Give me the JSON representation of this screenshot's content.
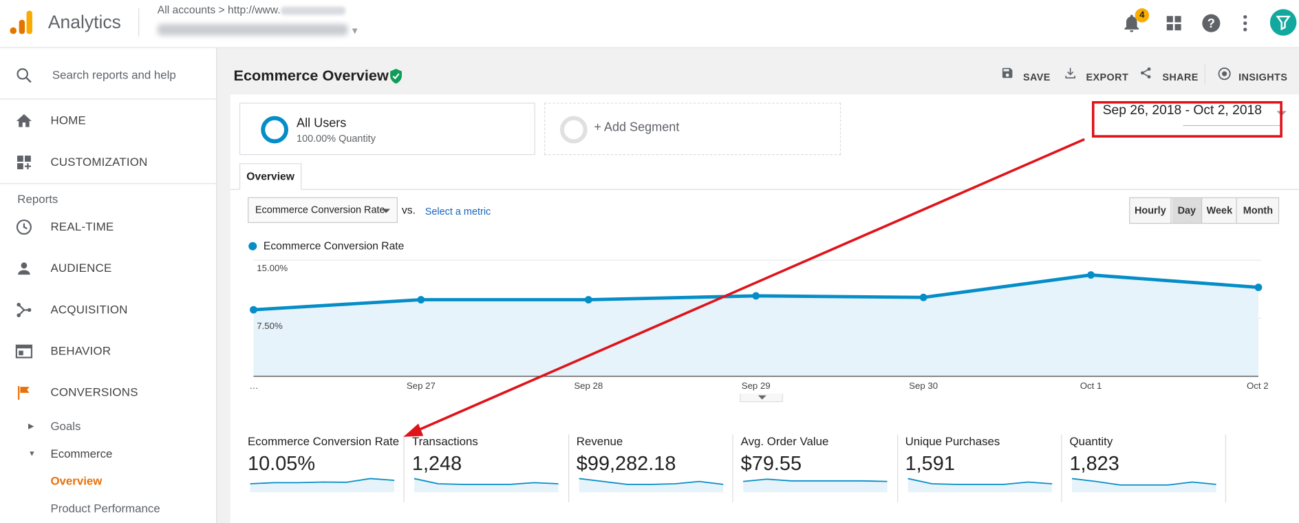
{
  "app": {
    "title": "Analytics",
    "breadcrumb_prefix": "All accounts",
    "breadcrumb_sep": ">",
    "breadcrumb_url": "http://www.",
    "property_dropdown": "▾",
    "notifications_count": "4",
    "brand_colors": {
      "logo_orange": "#f9ab00",
      "logo_dark": "#e37400",
      "accent_blue": "#058dc7",
      "active_orange": "#e8710a",
      "annotation_red": "#e0131a"
    }
  },
  "sidebar": {
    "search_placeholder": "Search reports and help",
    "home": "HOME",
    "customization": "CUSTOMIZATION",
    "reports_heading": "Reports",
    "realtime": "REAL-TIME",
    "audience": "AUDIENCE",
    "acquisition": "ACQUISITION",
    "behavior": "BEHAVIOR",
    "conversions": "CONVERSIONS",
    "goals": "Goals",
    "ecommerce": "Ecommerce",
    "overview": "Overview",
    "product_performance": "Product Performance"
  },
  "report": {
    "title": "Ecommerce Overview",
    "actions": {
      "save": "SAVE",
      "export": "EXPORT",
      "share": "SHARE",
      "insights": "INSIGHTS"
    },
    "segment": {
      "name": "All Users",
      "sub": "100.00% Quantity",
      "add": "+ Add Segment"
    },
    "date_range": "Sep 26, 2018 - Oct 2, 2018",
    "tab": "Overview",
    "metric_select": "Ecommerce Conversion Rate",
    "vs": "vs.",
    "select_metric": "Select a metric",
    "granularity": [
      "Hourly",
      "Day",
      "Week",
      "Month"
    ],
    "granularity_active": "Day",
    "legend": "Ecommerce Conversion Rate"
  },
  "chart_data": {
    "type": "area",
    "series": [
      {
        "name": "Ecommerce Conversion Rate",
        "values": [
          8.6,
          9.9,
          9.9,
          10.4,
          10.2,
          13.1,
          11.5
        ]
      }
    ],
    "x": [
      "…",
      "Sep 27",
      "Sep 28",
      "Sep 29",
      "Sep 30",
      "Oct 1",
      "Oct 2"
    ],
    "y_ticks": [
      "15.00%",
      "7.50%"
    ],
    "ylim": [
      0,
      15
    ],
    "color": "#058dc7",
    "fill": "#e6f3fa",
    "grid": true
  },
  "metrics": [
    {
      "label": "Ecommerce Conversion Rate",
      "value": "10.05%",
      "spark": [
        0.55,
        0.45,
        0.45,
        0.4,
        0.42,
        0.1,
        0.25
      ]
    },
    {
      "label": "Transactions",
      "value": "1,248",
      "spark": [
        0.1,
        0.55,
        0.6,
        0.6,
        0.6,
        0.45,
        0.55
      ]
    },
    {
      "label": "Revenue",
      "value": "$99,282.18",
      "spark": [
        0.1,
        0.35,
        0.6,
        0.6,
        0.55,
        0.35,
        0.6
      ]
    },
    {
      "label": "Avg. Order Value",
      "value": "$79.55",
      "spark": [
        0.35,
        0.15,
        0.3,
        0.3,
        0.3,
        0.3,
        0.35
      ]
    },
    {
      "label": "Unique Purchases",
      "value": "1,591",
      "spark": [
        0.1,
        0.55,
        0.6,
        0.6,
        0.6,
        0.4,
        0.55
      ]
    },
    {
      "label": "Quantity",
      "value": "1,823",
      "spark": [
        0.1,
        0.35,
        0.65,
        0.65,
        0.65,
        0.4,
        0.6
      ]
    }
  ]
}
